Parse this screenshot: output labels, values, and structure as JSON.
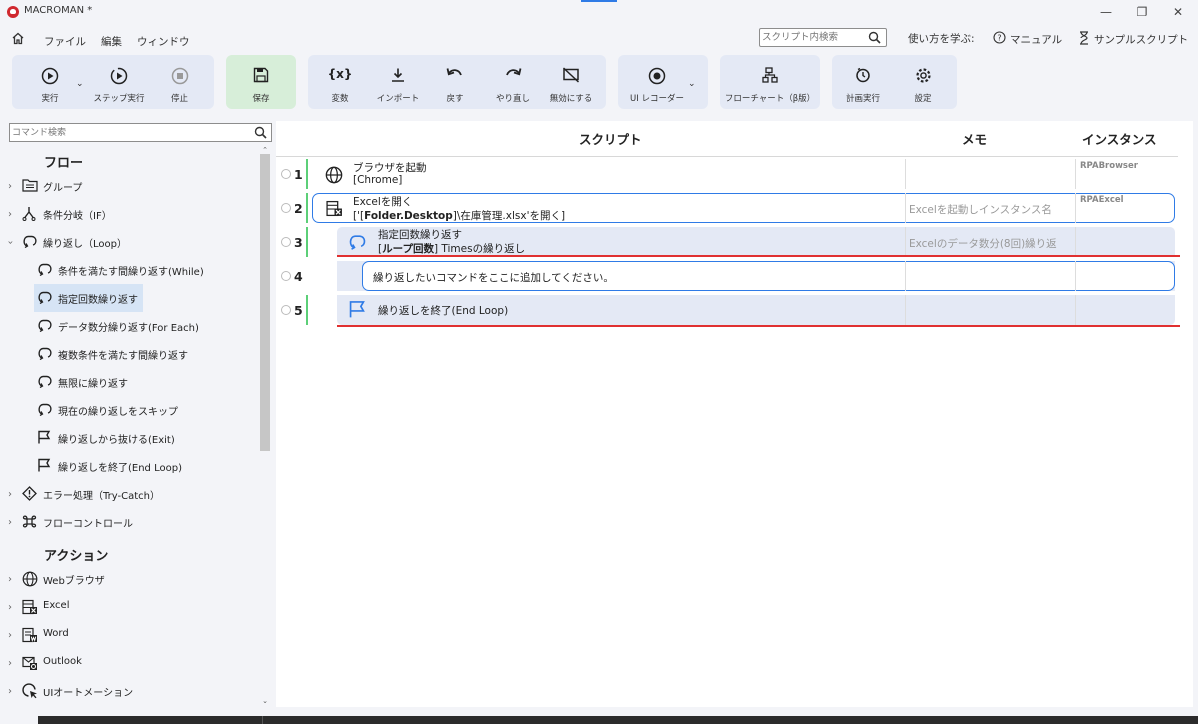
{
  "window": {
    "title": "MACROMAN *",
    "minimize": "—",
    "maximize": "❐",
    "close": "✕"
  },
  "menu": {
    "items": [
      "ファイル",
      "編集",
      "ウィンドウ"
    ],
    "script_search_placeholder": "スクリプト内検索",
    "help": [
      "使い方を学ぶ:",
      "マニュアル",
      "サンプルスクリプト"
    ]
  },
  "toolbar": {
    "run": "実行",
    "step_run": "ステップ実行",
    "stop": "停止",
    "save": "保存",
    "variables": "変数",
    "import": "インポート",
    "undo": "戻す",
    "redo": "やり直し",
    "disable": "無効にする",
    "ui_recorder": "UI レコーダー",
    "flowchart": "フローチャート（β版）",
    "schedule": "計画実行",
    "settings": "設定",
    "variables_glyph": "{x}"
  },
  "sidebar": {
    "search_placeholder": "コマンド検索",
    "flow_title": "フロー",
    "action_title": "アクション",
    "flow_items": [
      "グループ",
      "条件分岐（IF）",
      "繰り返し（Loop）",
      "条件を満たす間繰り返す(While)",
      "指定回数繰り返す",
      "データ数分繰り返す(For Each)",
      "複数条件を満たす間繰り返す",
      "無限に繰り返す",
      "現在の繰り返しをスキップ",
      "繰り返しから抜ける(Exit)",
      "繰り返しを終了(End Loop)",
      "エラー処理（Try-Catch）",
      "フローコントロール"
    ],
    "action_items": [
      "Webブラウザ",
      "Excel",
      "Word",
      "Outlook",
      "UIオートメーション"
    ]
  },
  "script": {
    "headers": {
      "script": "スクリプト",
      "memo": "メモ",
      "instance": "インスタンス"
    },
    "rows": [
      {
        "num": "1",
        "title": "ブラウザを起動",
        "detail": "[Chrome]",
        "memo": "",
        "instance": "RPABrowser"
      },
      {
        "num": "2",
        "title": "Excelを開く",
        "detail_pre": "['[",
        "detail_bold": "Folder.Desktop",
        "detail_post": "]\\在庫管理.xlsx'を開く]",
        "memo": "Excelを起動しインスタンス名",
        "instance": "RPAExcel"
      },
      {
        "num": "3",
        "title": "指定回数繰り返す",
        "detail_pre": "[",
        "detail_bold": "ループ回数",
        "detail_post": "] Timesの繰り返し",
        "memo": "Excelのデータ数分(8回)繰り返",
        "instance": ""
      },
      {
        "num": "4",
        "title": "繰り返したいコマンドをここに追加してください。",
        "memo": "",
        "instance": ""
      },
      {
        "num": "5",
        "title": "繰り返しを終了(End Loop)",
        "memo": "",
        "instance": ""
      }
    ]
  },
  "colors": {
    "accent": "#2f7be6",
    "loop_bg": "#e4e9f5",
    "save_bg": "#d7eed9",
    "green_bar": "#5ccf78",
    "red_line": "#e03030"
  }
}
